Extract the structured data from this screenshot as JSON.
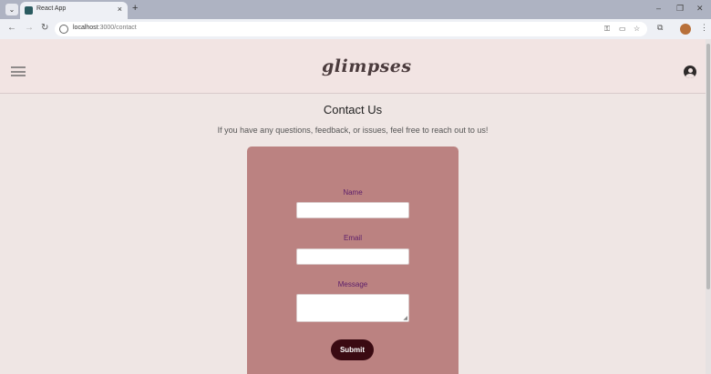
{
  "browser": {
    "tab_title": "React App",
    "tab_close": "×",
    "new_tab": "+",
    "url_host": "localhost",
    "url_path": ":3000/contact",
    "window_controls": {
      "minimize": "–",
      "restore": "❐",
      "close": "✕"
    }
  },
  "header": {
    "logo": "glimpses",
    "icons": {
      "menu": "hamburger-icon",
      "user": "user-circle-icon"
    }
  },
  "main": {
    "title": "Contact Us",
    "subtitle": "If you have any questions, feedback, or issues, feel free to reach out to us!"
  },
  "form": {
    "name_label": "Name",
    "name_value": "",
    "email_label": "Email",
    "email_value": "",
    "message_label": "Message",
    "message_value": "",
    "submit_label": "Submit"
  },
  "colors": {
    "card": "#bb8281",
    "label": "#5c1e6a",
    "button": "#3a0a12",
    "header_bg": "#f2e4e3",
    "page_bg": "#efe6e4"
  }
}
